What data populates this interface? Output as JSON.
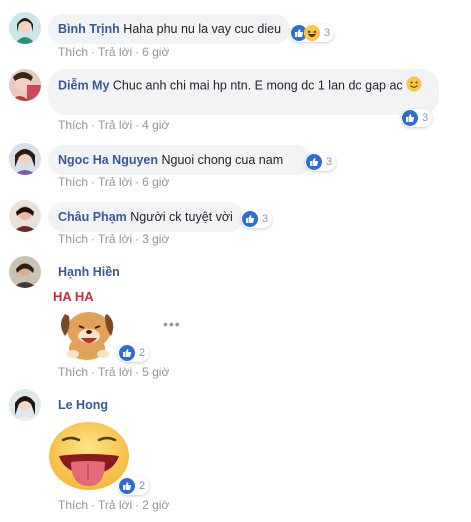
{
  "actions": {
    "like": "Thích",
    "reply": "Trả lời"
  },
  "comments": [
    {
      "author": "Bình Trịnh",
      "text": "Haha phu nu la vay cuc dieu",
      "time": "6 giờ",
      "reactions": [
        "like",
        "haha"
      ],
      "count": "3"
    },
    {
      "author": "Diễm My",
      "text": "Chuc anh chi mai hp ntn. E mong dc 1 lan dc gap ac",
      "time": "4 giờ",
      "reactions": [
        "like"
      ],
      "count": "3"
    },
    {
      "author": "Ngoc Ha Nguyen",
      "text": "Nguoi chong cua nam",
      "time": "6 giờ",
      "reactions": [
        "like"
      ],
      "count": "3"
    },
    {
      "author": "Châu Phạm",
      "text": "Người ck tuyệt vời",
      "time": "3 giờ",
      "reactions": [
        "like"
      ],
      "count": "3"
    },
    {
      "author": "Hạnh Hiền",
      "sticker_text": "HA HA",
      "sticker": "laughing-dog-sticker",
      "time": "5 giờ",
      "reactions": [
        "like"
      ],
      "count": "2",
      "more": "•••"
    },
    {
      "author": "Le Hong",
      "sticker": "tongue-out-emoji-sticker",
      "time": "2 giờ",
      "reactions": [
        "like"
      ],
      "count": "2"
    }
  ],
  "colors": {
    "author": "#385898",
    "bubble": "#f2f3f5",
    "like": "#2b6fd6",
    "meta": "#90949c"
  },
  "icons": {
    "like": "thumbs-up-icon",
    "haha": "haha-emoji-icon",
    "smile": "smile-emoji-icon"
  }
}
